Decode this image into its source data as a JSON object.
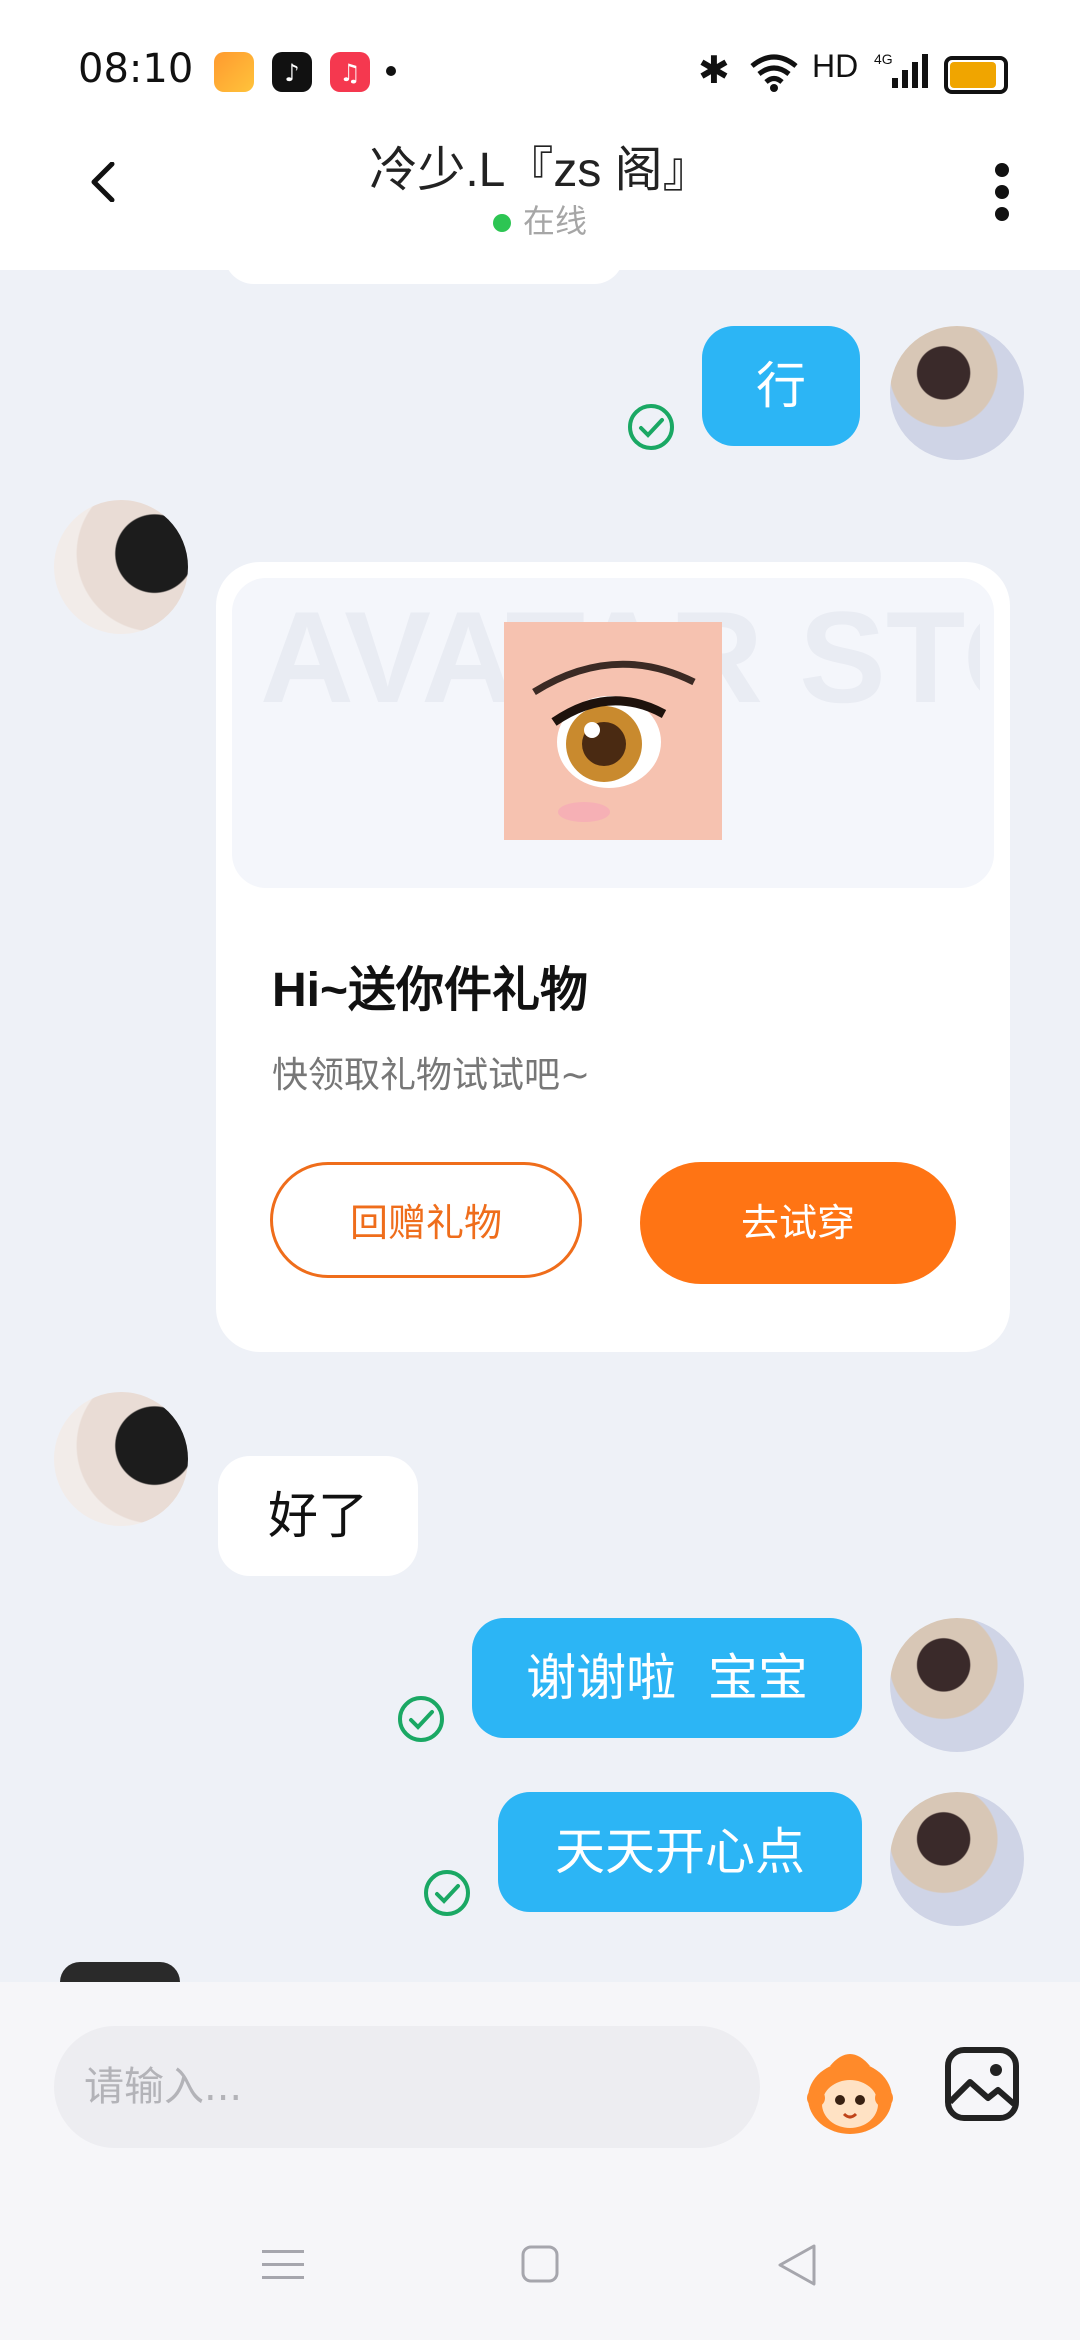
{
  "status_bar": {
    "time": "08:10",
    "network_label": "HD",
    "signal_label": "4G"
  },
  "header": {
    "title": "冷少.L『zs 阁』",
    "status": "在线",
    "status_color": "#2dc553"
  },
  "messages": [
    {
      "side": "right",
      "type": "text",
      "text": "行",
      "read": true
    },
    {
      "side": "left",
      "type": "gift_card"
    },
    {
      "side": "left",
      "type": "text",
      "text": "好了"
    },
    {
      "side": "right",
      "type": "text",
      "text": "谢谢啦  宝宝",
      "read": true
    },
    {
      "side": "right",
      "type": "text",
      "text": "天天开心点",
      "read": true
    }
  ],
  "gift_card": {
    "title": "Hi~送你件礼物",
    "subtitle": "快领取礼物试试吧~",
    "watermark": "AVATAR STORE",
    "return_button": "回赠礼物",
    "try_button": "去试穿"
  },
  "composer": {
    "placeholder": "请输入..."
  },
  "colors": {
    "bubble_mine": "#2cb5f5",
    "accent_orange": "#ff7414",
    "read_check": "#1aa864"
  },
  "icons": [
    "back-arrow-icon",
    "more-icon",
    "read-check-icon",
    "mascot-emoji-icon",
    "image-icon",
    "nav-menu-icon",
    "nav-home-icon",
    "nav-back-icon",
    "wifi-icon",
    "bluetooth-icon",
    "battery-icon"
  ]
}
